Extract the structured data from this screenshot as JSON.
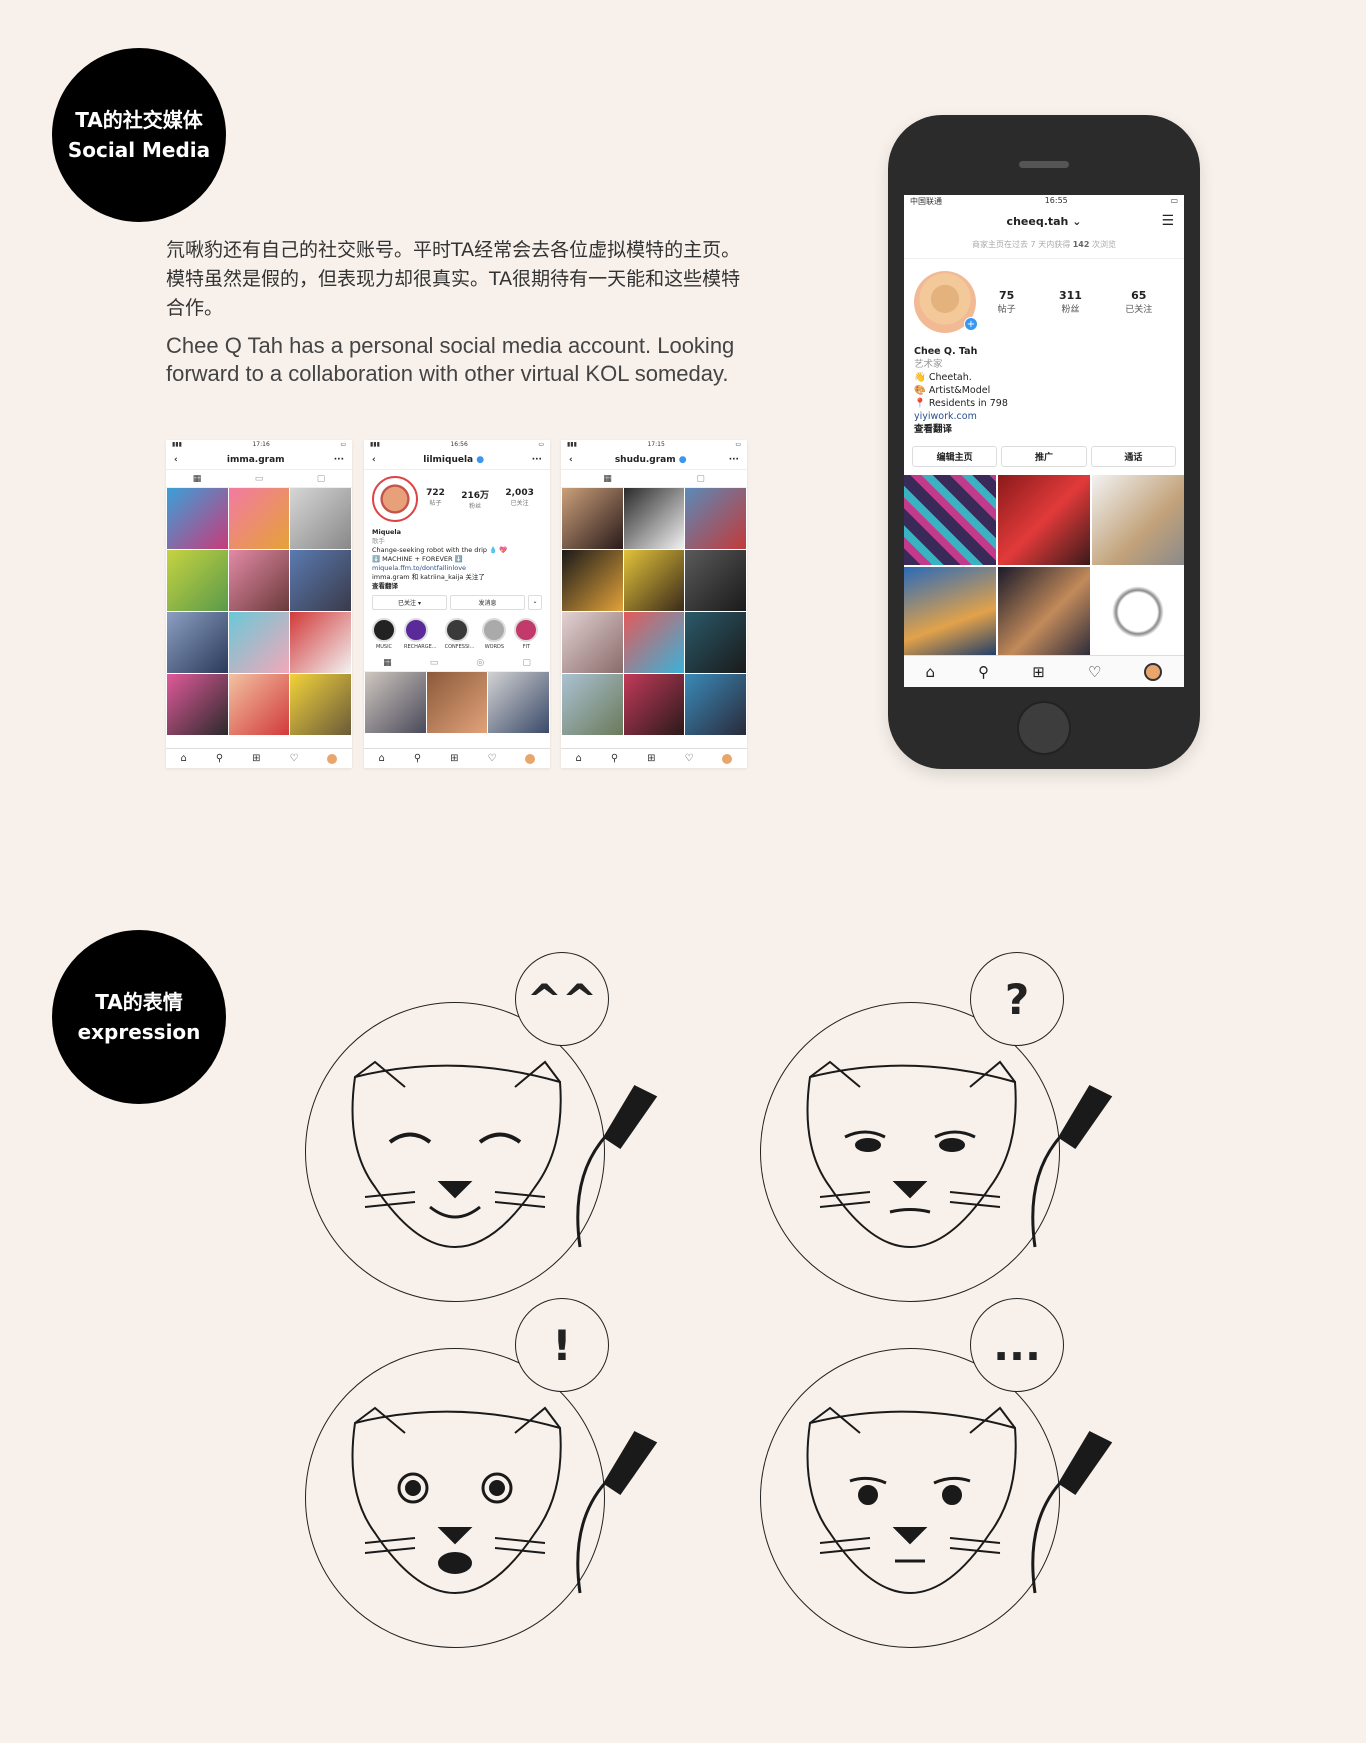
{
  "section1": {
    "title_zh": "TA的社交媒体",
    "title_en": "Social Media"
  },
  "intro": {
    "zh": "氘啾豹还有自己的社交账号。平时TA经常会去各位虚拟模特的主页。模特虽然是假的，但表现力却很真实。TA很期待有一天能和这些模特合作。",
    "en": "Chee Q Tah has a personal social media account. Looking forward to a collaboration with other virtual KOL someday."
  },
  "shot1": {
    "time": "17:16",
    "username": "imma.gram"
  },
  "shot2": {
    "time": "16:56",
    "username": "lilmiquela",
    "posts": "722",
    "posts_label": "帖子",
    "followers": "216万",
    "followers_label": "粉丝",
    "following": "2,003",
    "following_label": "已关注",
    "name": "Miquela",
    "role": "歌手",
    "bio1": "Change-seeking robot with the drip 💧 💖",
    "bio2": "⬇️ MACHINE + FOREVER ⬇️",
    "link": "miquela.ffm.to/dontfallinlove",
    "followed_by": "imma.gram 和 katriina_kaija 关注了",
    "translate": "查看翻译",
    "btn_following": "已关注 ▾",
    "btn_message": "发消息",
    "highlights": [
      "MUSIC",
      "RECHARGE...",
      "CONFESSI...",
      "WORDS",
      "FIT"
    ]
  },
  "shot3": {
    "time": "17:15",
    "username": "shudu.gram"
  },
  "phone": {
    "carrier": "中国联通",
    "time": "16:55",
    "username": "cheeq.tah",
    "notice_prefix": "商家主页在过去 7 天内获得 ",
    "notice_count": "142",
    "notice_suffix": " 次浏览",
    "posts": "75",
    "posts_label": "帖子",
    "followers": "311",
    "followers_label": "粉丝",
    "following": "65",
    "following_label": "已关注",
    "name": "Chee Q. Tah",
    "category": "艺术家",
    "bio1": "👋 Cheetah.",
    "bio2": "🎨 Artist&Model",
    "bio3": "📍 Residents in 798",
    "link": "yiyiwork.com",
    "translate": "查看翻译",
    "btn_edit": "编辑主页",
    "btn_promote": "推广",
    "btn_contact": "通话"
  },
  "section2": {
    "title_zh": "TA的表情",
    "title_en": "expression"
  },
  "expressions": [
    {
      "symbol": "^^"
    },
    {
      "symbol": "?"
    },
    {
      "symbol": "!"
    },
    {
      "symbol": "..."
    }
  ],
  "colors": {
    "background": "#f8f1eb",
    "badge": "#000000",
    "link": "#2a4d8f",
    "accent_blue": "#3897f0"
  }
}
